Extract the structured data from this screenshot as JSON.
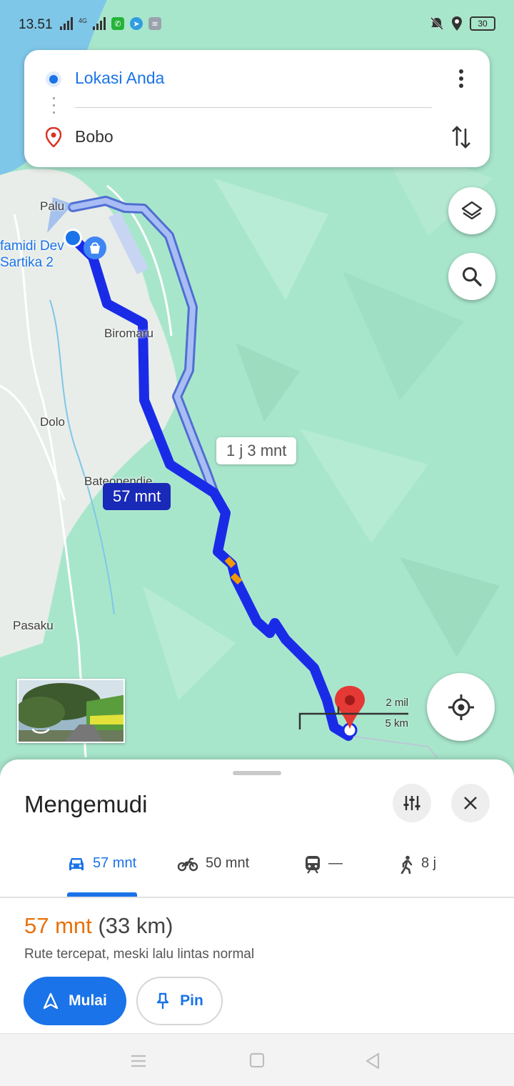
{
  "status_bar": {
    "time": "13.51",
    "network_label": "4G",
    "battery": "30"
  },
  "search": {
    "origin": "Lokasi Anda",
    "destination": "Bobo"
  },
  "map": {
    "places": {
      "palu": "Palu",
      "poi": "famidi Dev\nSartika 2",
      "biromaru": "Biromaru",
      "dolo": "Dolo",
      "bateopendie": "Bateopendie",
      "pasaku": "Pasaku"
    },
    "alt_route_time": "1 j 3 mnt",
    "main_route_time": "57 mnt",
    "scale_mi": "2 mil",
    "scale_km": "5 km",
    "colors": {
      "route_main": "#1a2be8",
      "route_alt": "#a9bdf5",
      "traffic": "#f29900",
      "destination_pin": "#e53935"
    }
  },
  "sheet": {
    "title": "Mengemudi",
    "modes": [
      {
        "icon": "car-icon",
        "label": "57 mnt",
        "active": true
      },
      {
        "icon": "motorcycle-icon",
        "label": "50 mnt",
        "active": false
      },
      {
        "icon": "train-icon",
        "label": "—",
        "active": false
      },
      {
        "icon": "walk-icon",
        "label": "8 j",
        "active": false
      }
    ],
    "duration": "57 mnt",
    "distance": "(33 km)",
    "description": "Rute tercepat, meski lalu lintas normal",
    "start_label": "Mulai",
    "pin_label": "Pin"
  }
}
